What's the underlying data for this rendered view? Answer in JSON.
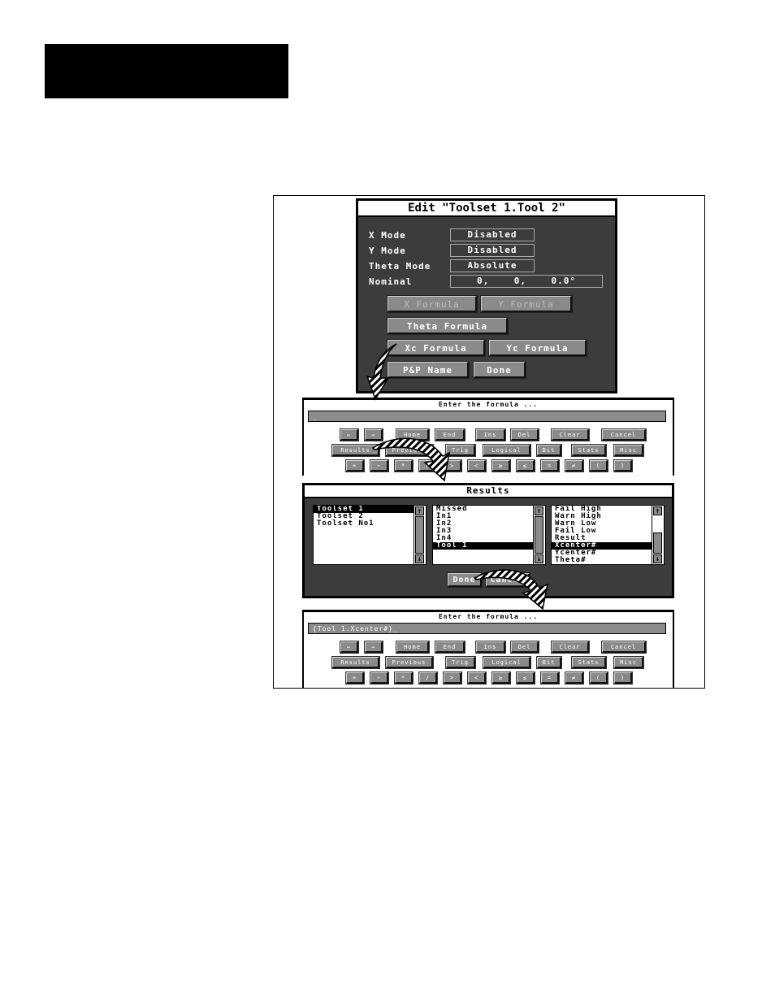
{
  "edit_dialog": {
    "title": "Edit \"Toolset 1.Tool 2\"",
    "fields": [
      {
        "label": "X Mode",
        "value": "Disabled"
      },
      {
        "label": "Y Mode",
        "value": "Disabled"
      },
      {
        "label": "Theta Mode",
        "value": "Absolute"
      },
      {
        "label": "Nominal",
        "value": "0,    0,    0.0°"
      }
    ],
    "buttons": {
      "x_formula": "X Formula",
      "y_formula": "Y Formula",
      "theta_formula": "Theta Formula",
      "xc_formula": "Xc Formula",
      "yc_formula": "Yc Formula",
      "pp_name": "P&P Name",
      "done": "Done"
    },
    "disabled_buttons": [
      "X Formula",
      "Y Formula"
    ]
  },
  "formula_panel_1": {
    "prompt": "Enter the formula ...",
    "input_value": "_"
  },
  "formula_panel_2": {
    "prompt": "Enter the formula ...",
    "input_value": "{Tool 1.Xcenter#}_"
  },
  "keypad": {
    "row1": [
      "←",
      "→",
      "Home",
      "End",
      "Ins",
      "Del",
      "Clear",
      "Cancel"
    ],
    "row2": [
      "Results",
      "Previous",
      "Trig",
      "Logical",
      "Bit",
      "Stats",
      "Misc"
    ],
    "row3": [
      "+",
      "−",
      "*",
      "/",
      ">",
      "<",
      "≥",
      "≤",
      "=",
      "≠",
      "(",
      ")"
    ]
  },
  "results_dialog": {
    "title": "Results",
    "toolsets": {
      "items": [
        "Toolset 1",
        "Toolset 2",
        "Toolset No1"
      ],
      "selected": "Toolset 1"
    },
    "tools": {
      "items": [
        "Missed",
        "In1",
        "In2",
        "In3",
        "In4",
        "Tool 1"
      ],
      "selected": "Tool 1"
    },
    "results": {
      "items": [
        "Fail High",
        "Warn High",
        "Warn Low",
        "Fail Low",
        "Result",
        "Xcenter#",
        "Ycenter#",
        "Theta#"
      ],
      "selected": "Xcenter#"
    },
    "buttons": {
      "done": "Done",
      "cancel": "Cancel"
    },
    "scroll_up": "↑",
    "scroll_down": "↓"
  }
}
